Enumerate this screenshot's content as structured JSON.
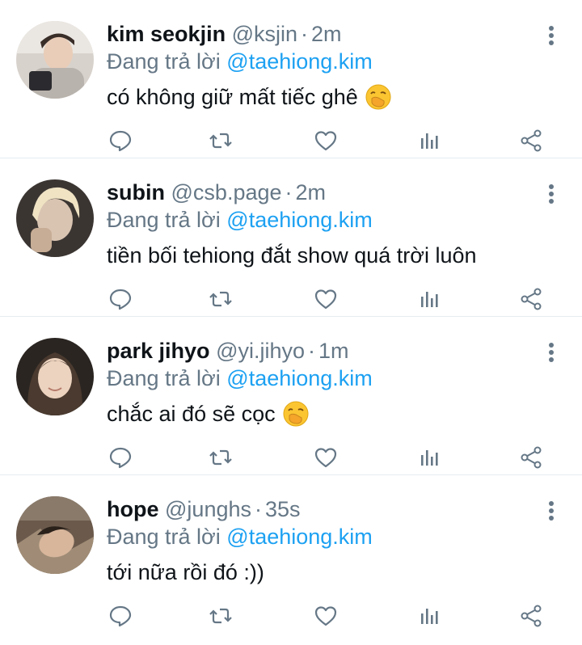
{
  "colors": {
    "text": "#0f1419",
    "muted": "#657786",
    "link": "#1da1f2",
    "divider": "#e6ecf0",
    "icon": "#657786"
  },
  "reply_prefix": "Đang trả lời",
  "tweets": [
    {
      "name": "kim seokjin",
      "handle": "@ksjin",
      "separator": "·",
      "time": "2m",
      "reply_to": "@taehiong.kim",
      "text": "có không giữ mất tiếc ghê",
      "emoji": "face-with-hand-over-mouth"
    },
    {
      "name": "subin",
      "handle": "@csb.page",
      "separator": "·",
      "time": "2m",
      "reply_to": "@taehiong.kim",
      "text": "tiền bối tehiong đắt show quá trời luôn",
      "emoji": ""
    },
    {
      "name": "park jihyo",
      "handle": "@yi.jihyo",
      "separator": "·",
      "time": "1m",
      "reply_to": "@taehiong.kim",
      "text": "chắc ai đó sẽ cọc",
      "emoji": "face-with-hand-over-mouth"
    },
    {
      "name": "hope",
      "handle": "@junghs",
      "separator": "·",
      "time": "35s",
      "reply_to": "@taehiong.kim",
      "text": "tới nữa rồi đó :))",
      "emoji": ""
    }
  ]
}
